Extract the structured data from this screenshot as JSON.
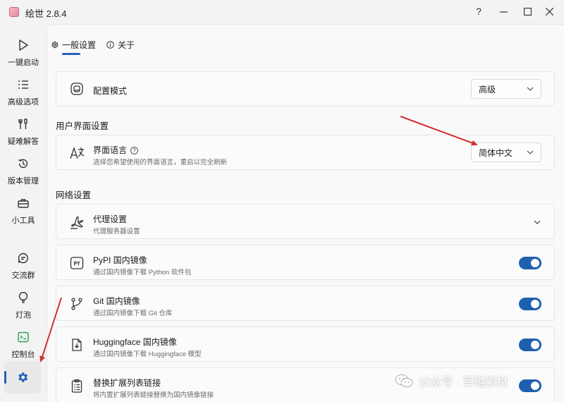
{
  "window": {
    "title": "绘世 2.8.4",
    "help_glyph": "?",
    "minimize_glyph": "—",
    "maximize_glyph": "☐",
    "close_glyph": "✕"
  },
  "sidebar": {
    "items": [
      {
        "label": "一键启动",
        "icon": "play-icon"
      },
      {
        "label": "高级选项",
        "icon": "list-icon"
      },
      {
        "label": "疑难解答",
        "icon": "wrench-icon"
      },
      {
        "label": "版本管理",
        "icon": "history-icon"
      },
      {
        "label": "小工具",
        "icon": "toolbox-icon"
      },
      {
        "label": "交流群",
        "icon": "chat-icon"
      },
      {
        "label": "灯泡",
        "icon": "bulb-icon"
      },
      {
        "label": "控制台",
        "icon": "console-icon"
      }
    ],
    "settings_icon": "gear-icon"
  },
  "tabs": [
    {
      "label": "一般设置",
      "icon": "gear-icon",
      "active": true
    },
    {
      "label": "关于",
      "icon": "info-icon",
      "active": false
    }
  ],
  "config_mode": {
    "title": "配置模式",
    "value": "高级"
  },
  "ui_section": "用户界面设置",
  "language": {
    "title": "界面语言",
    "help": "?",
    "subtitle": "选择您希望使用的界面语言，重启以完全刷新",
    "value": "简体中文"
  },
  "network_section": "网络设置",
  "proxy": {
    "title": "代理设置",
    "subtitle": "代理服务器设置"
  },
  "pypi": {
    "title": "PyPI 国内镜像",
    "subtitle": "通过国内镜像下载 Python 软件包",
    "icon_text": "PY",
    "enabled": true
  },
  "git": {
    "title": "Git 国内镜像",
    "subtitle": "通过国内镜像下载 Git 仓库",
    "enabled": true
  },
  "huggingface": {
    "title": "Huggingface 国内镜像",
    "subtitle": "通过国内镜像下载 Huggingface 模型",
    "enabled": true
  },
  "extension": {
    "title": "替换扩展列表链接",
    "subtitle": "将内置扩展列表链接替换为国内镜像链接",
    "enabled": true
  },
  "watermark": {
    "text": "公众号 · 军璐素材"
  },
  "colors": {
    "accent": "#1f5fb0",
    "annotation": "#d32f2f",
    "console_icon": "#2e9e4f"
  }
}
